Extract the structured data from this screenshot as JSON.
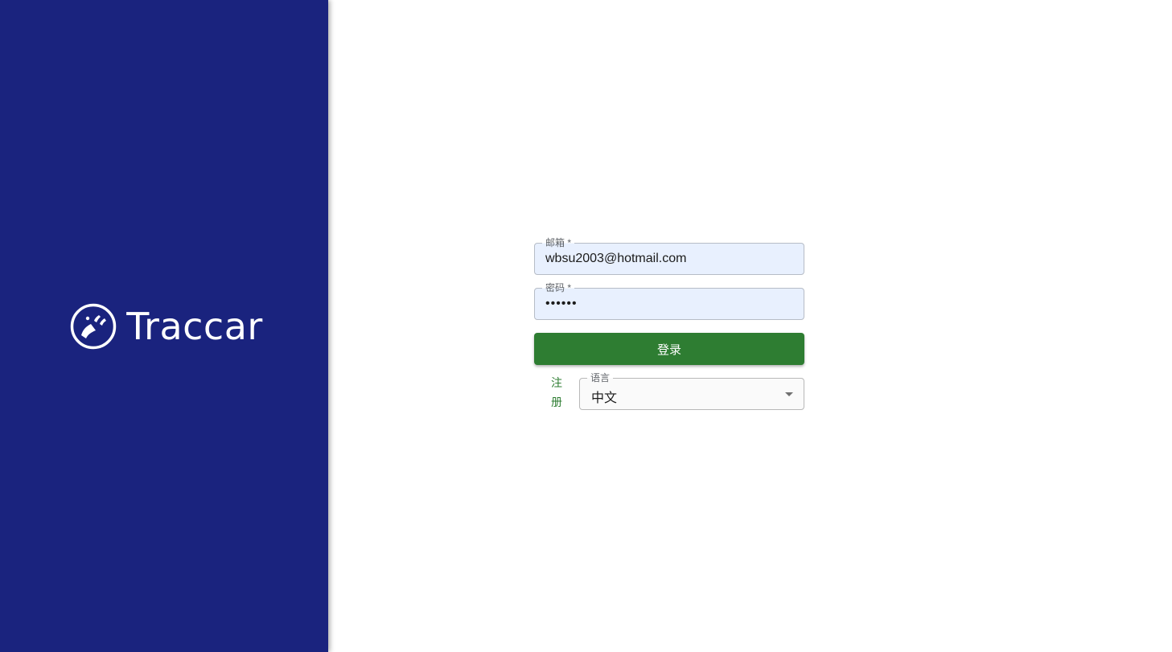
{
  "brand": {
    "name": "Traccar"
  },
  "form": {
    "email": {
      "label": "邮箱 *",
      "value": "wbsu2003@hotmail.com"
    },
    "password": {
      "label": "密码 *",
      "value": "••••••"
    },
    "login_label": "登录",
    "register_label": "注册",
    "language": {
      "label": "语言",
      "selected": "中文"
    }
  },
  "colors": {
    "sidebar": "#1a237e",
    "primary_button": "#2e7d32",
    "autofill_field": "#e8f0fe"
  }
}
